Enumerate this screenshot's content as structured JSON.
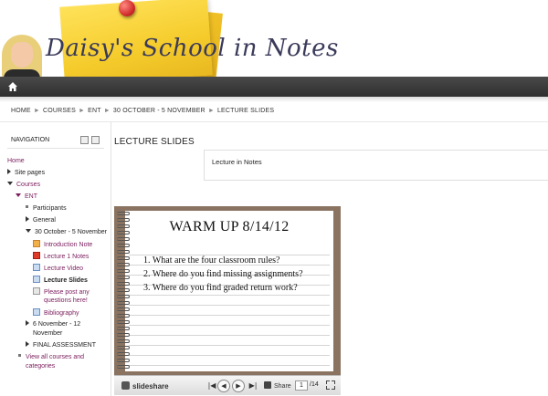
{
  "header": {
    "site_title": "Daisy's School in Notes"
  },
  "breadcrumb": {
    "items": [
      "HOME",
      "COURSES",
      "ENT",
      "30 OCTOBER - 5 NOVEMBER",
      "LECTURE SLIDES"
    ]
  },
  "navigation": {
    "title": "NAVIGATION",
    "home": "Home",
    "site_pages": "Site pages",
    "courses": "Courses",
    "course": "ENT",
    "participants": "Participants",
    "general": "General",
    "week1": "30 October - 5 November",
    "resources": [
      {
        "label": "Introduction Note",
        "icon": "orange"
      },
      {
        "label": "Lecture 1 Notes",
        "icon": "red"
      },
      {
        "label": "Lecture Video",
        "icon": "blue"
      },
      {
        "label": "Lecture Slides",
        "icon": "blue"
      },
      {
        "label": "Please post any",
        "label2": "questions here!",
        "icon": "gray"
      },
      {
        "label": "Bibliography",
        "icon": "blue"
      }
    ],
    "week2_line1": "6 November - 12",
    "week2_line2": "November",
    "final": "FINAL ASSESSMENT",
    "view_all_line1": "View all courses and",
    "view_all_line2": "categories"
  },
  "main": {
    "title": "LECTURE SLIDES",
    "description": "Lecture in Notes"
  },
  "slideshow": {
    "slide_title": "WARM UP 8/14/12",
    "lines": [
      "1.  What are the four classroom rules?",
      "2.  Where do you find missing assignments?",
      "3.  Where do you find graded return work?"
    ],
    "logo": "slideshare",
    "share_label": "Share",
    "current_page": "1",
    "total_pages": "/14"
  },
  "colors": {
    "nav_bar": "#333333",
    "link": "#7a1c5c",
    "slide_frame": "#8a7461",
    "sticky_note": "#f5cc2c"
  }
}
